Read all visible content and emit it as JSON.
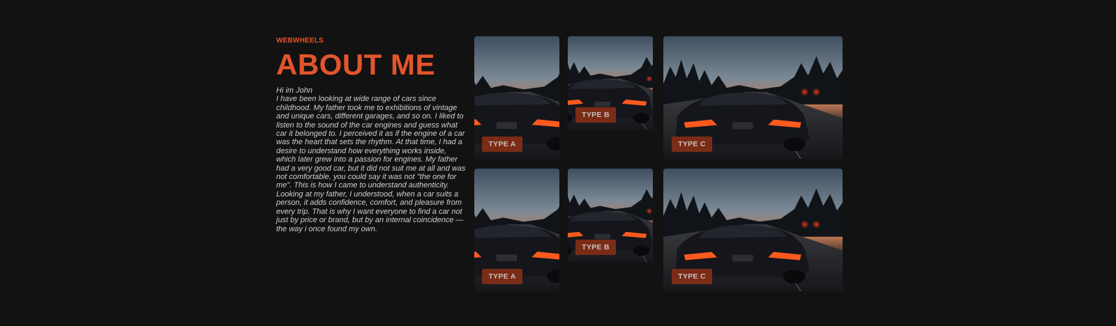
{
  "brand": "WEBWHEELS",
  "title": "ABOUT ME",
  "greeting": "Hi im John",
  "bio": "I have been looking at wide range of cars since childhood. My father took me to exhibitions of vintage and unique cars, different garages, and so on. I liked to listen to the sound of the car engines and guess what car it belonged to. I perceived it as if the engine of a car was the heart that sets the rhythm. At that time, I had a desire to understand how everything works inside, which later grew into a passion for engines. My father had a very good car, but it did not suit me at all and was not comfortable, you could say it was not \"the one for me\". This is how I came to understand authenticity. Looking at my father, I understood, when a car suits a person, it adds confidence, comfort, and pleasure from every trip. That is why I want everyone to find a car not just by price or brand, but by an internal coincidence — the way i once found my own.",
  "gallery": {
    "accent_color": "#e4552b",
    "button_color": "#7a2c17",
    "cards": [
      {
        "label": "TYPE A",
        "image": "black-sports-car-rear-photo"
      },
      {
        "label": "TYPE B",
        "image": "black-sports-car-rear-photo"
      },
      {
        "label": "TYPE C",
        "image": "black-sports-car-rear-photo"
      },
      {
        "label": "TYPE A",
        "image": "black-sports-car-rear-photo"
      },
      {
        "label": "TYPE B",
        "image": "black-sports-car-rear-photo"
      },
      {
        "label": "TYPE C",
        "image": "black-sports-car-rear-photo"
      }
    ]
  }
}
